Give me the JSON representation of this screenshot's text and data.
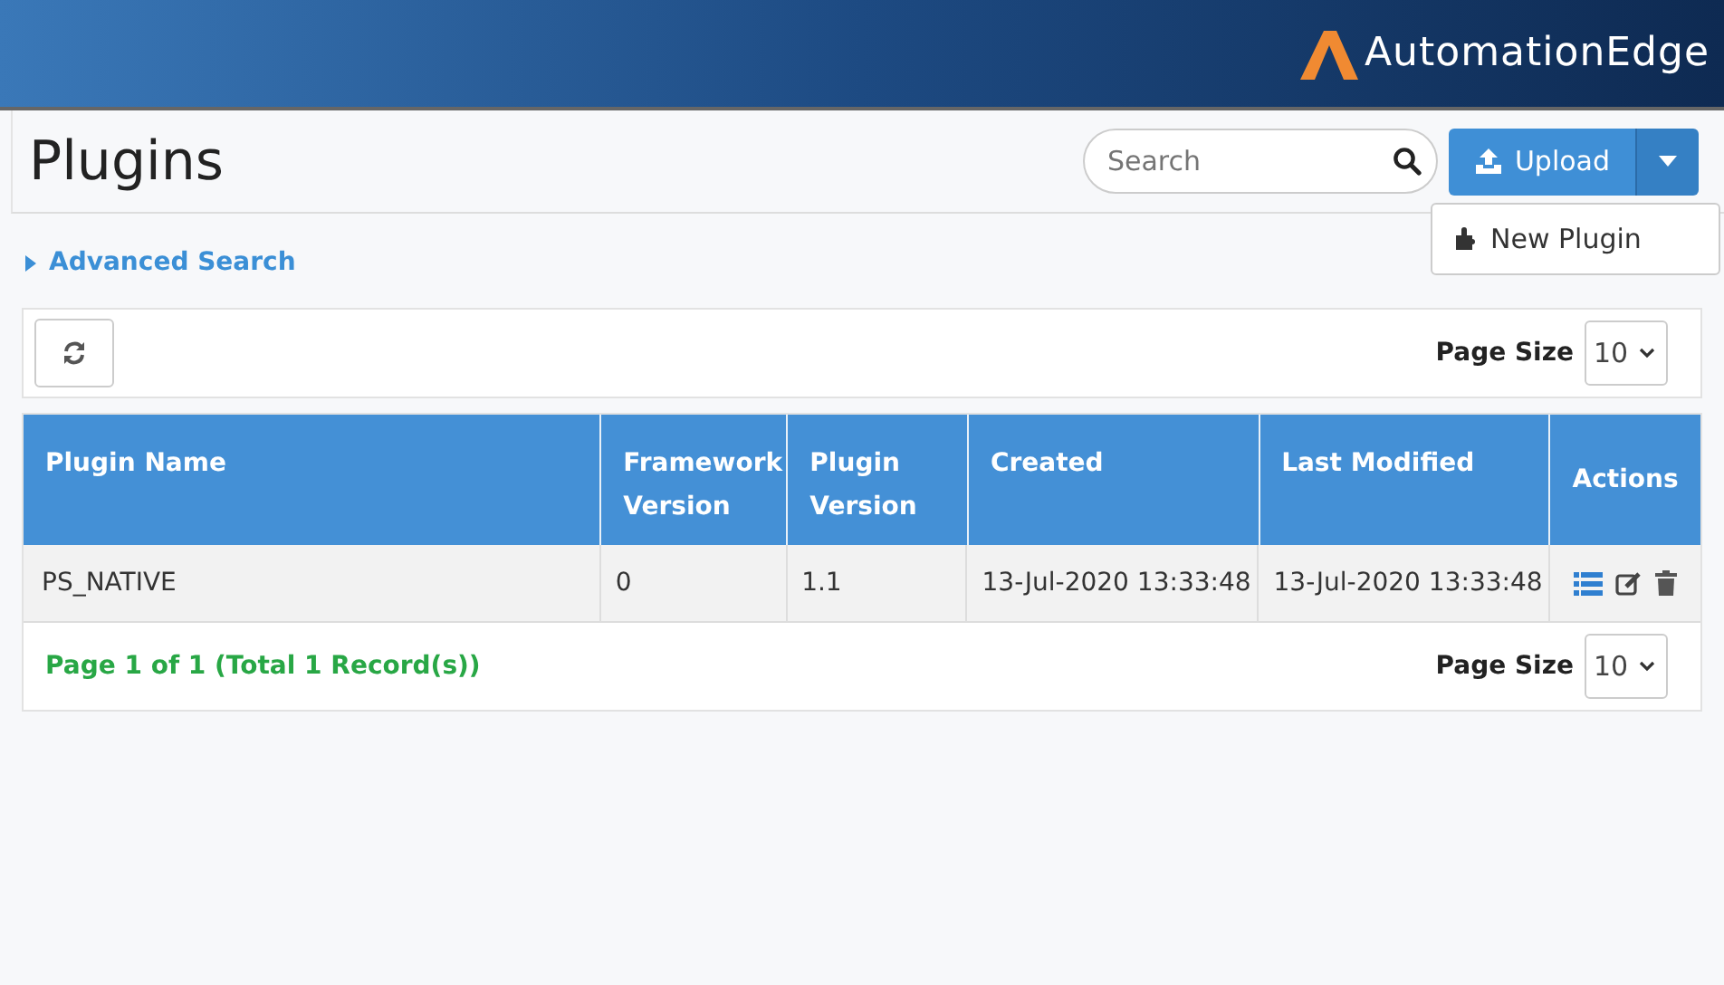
{
  "header": {
    "logo_text": "AutomationEdge"
  },
  "page": {
    "title": "Plugins",
    "search": {
      "placeholder": "Search"
    },
    "upload_button": "Upload",
    "upload_menu": {
      "expanded": true,
      "items": [
        "New Plugin"
      ]
    }
  },
  "advanced_search": {
    "label": "Advanced Search",
    "expanded": false
  },
  "toolbar": {
    "page_size_label": "Page Size",
    "page_size": "10"
  },
  "table": {
    "columns": [
      "Plugin Name",
      "Framework Version",
      "Plugin Version",
      "Created",
      "Last Modified",
      "Actions"
    ],
    "rows": [
      {
        "cells": [
          "PS_NATIVE",
          "0",
          "1.1",
          "13-Jul-2020 13:33:48",
          "13-Jul-2020 13:33:48"
        ]
      }
    ]
  },
  "footer": {
    "summary": "Page 1 of 1 (Total 1 Record(s))",
    "page_size_label": "Page Size",
    "page_size": "10"
  }
}
